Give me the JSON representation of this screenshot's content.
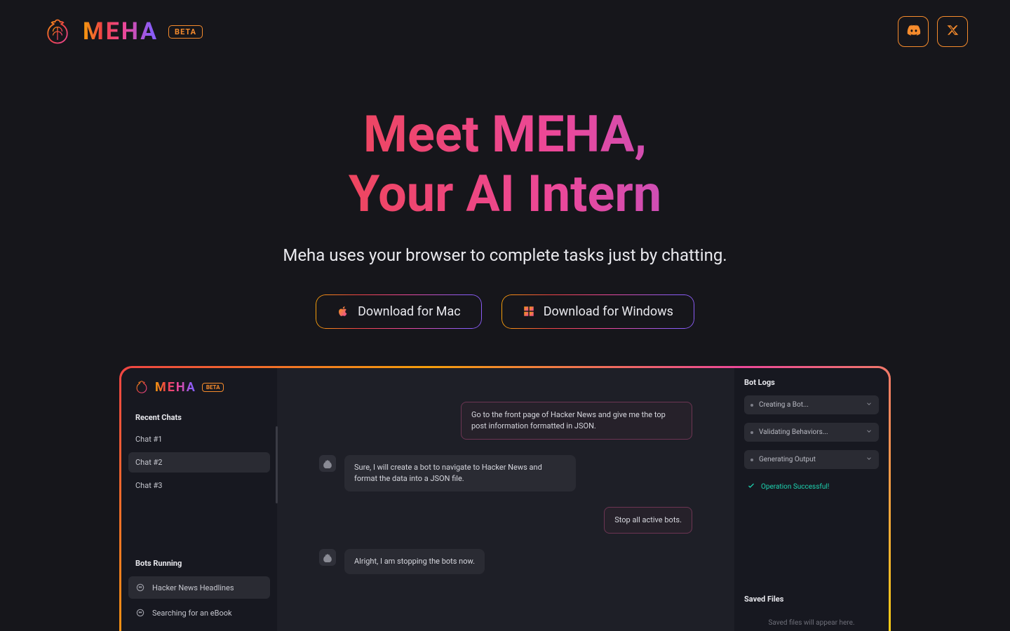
{
  "nav": {
    "brand_name": "MEHA",
    "beta_label": "BETA",
    "discord_icon": "discord",
    "x_icon": "x"
  },
  "hero": {
    "headline_line1": "Meet MEHA,",
    "headline_line2": "Your AI Intern",
    "subhead": "Meha uses your browser to complete tasks just by chatting.",
    "download_mac": "Download for Mac",
    "download_win": "Download for Windows"
  },
  "mock": {
    "brand_name": "MEHA",
    "beta_label": "BETA",
    "sidebar": {
      "recent_title": "Recent Chats",
      "chats": [
        "Chat #1",
        "Chat #2",
        "Chat #3"
      ],
      "active_index": 1,
      "bots_title": "Bots Running",
      "bots": [
        "Hacker News Headlines",
        "Searching for an eBook"
      ],
      "active_bot_index": 0
    },
    "chat": {
      "msg_user_1": "Go to the front page of Hacker News and give me the top post information formatted in JSON.",
      "msg_bot_1": "Sure, I will create a bot to navigate to Hacker News and format the data into a JSON file.",
      "msg_user_2": "Stop all active bots.",
      "msg_bot_2": "Alright, I am stopping the bots now."
    },
    "right": {
      "logs_title": "Bot Logs",
      "logs": [
        "Creating a Bot...",
        "Validating Behaviors...",
        "Generating Output"
      ],
      "success_label": "Operation Successful!",
      "saved_title": "Saved Files",
      "saved_placeholder": "Saved files will appear here."
    }
  }
}
